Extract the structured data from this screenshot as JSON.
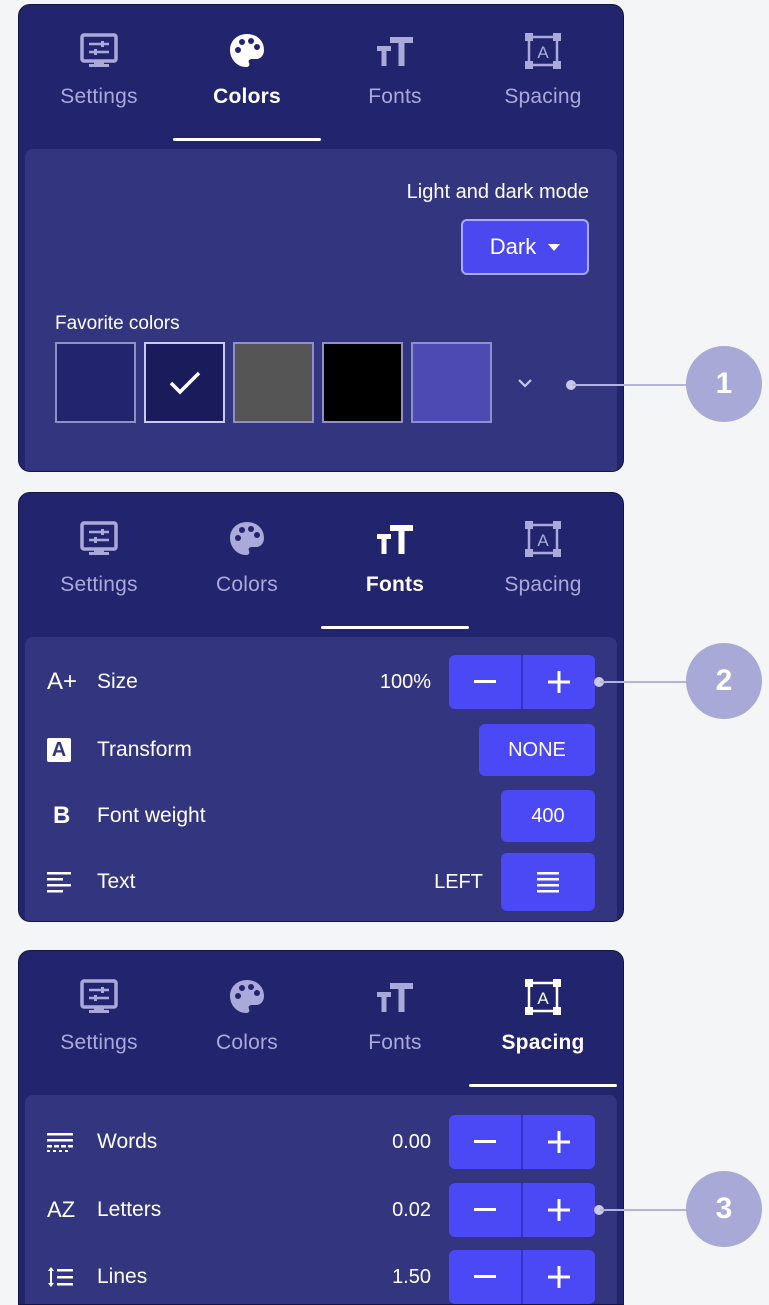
{
  "tabs": {
    "settings": "Settings",
    "colors": "Colors",
    "fonts": "Fonts",
    "spacing": "Spacing"
  },
  "colors_panel": {
    "mode_label": "Light and dark mode",
    "mode_value": "Dark",
    "favorites_label": "Favorite colors",
    "swatches": [
      {
        "color": "#23246e",
        "selected": false
      },
      {
        "color": "#1a1b5a",
        "selected": true
      },
      {
        "color": "#555555",
        "selected": false
      },
      {
        "color": "#000000",
        "selected": false
      },
      {
        "color": "#4d4ab3",
        "selected": false
      }
    ]
  },
  "fonts_panel": {
    "size": {
      "label": "Size",
      "value": "100%",
      "icon": "A+"
    },
    "transform": {
      "label": "Transform",
      "value": "NONE",
      "icon": "A"
    },
    "weight": {
      "label": "Font weight",
      "value": "400",
      "icon": "B"
    },
    "text": {
      "label": "Text",
      "value": "LEFT"
    }
  },
  "spacing_panel": {
    "words": {
      "label": "Words",
      "value": "0.00"
    },
    "letters": {
      "label": "Letters",
      "value": "0.02",
      "icon": "AZ"
    },
    "lines": {
      "label": "Lines",
      "value": "1.50"
    }
  },
  "callouts": [
    "1",
    "2",
    "3"
  ],
  "colors": {
    "panel_bg": "#23246e",
    "body_bg": "#34357f",
    "accent": "#4b48f5",
    "inactive_text": "#a9aad9",
    "callout": "#a8a9d6"
  }
}
